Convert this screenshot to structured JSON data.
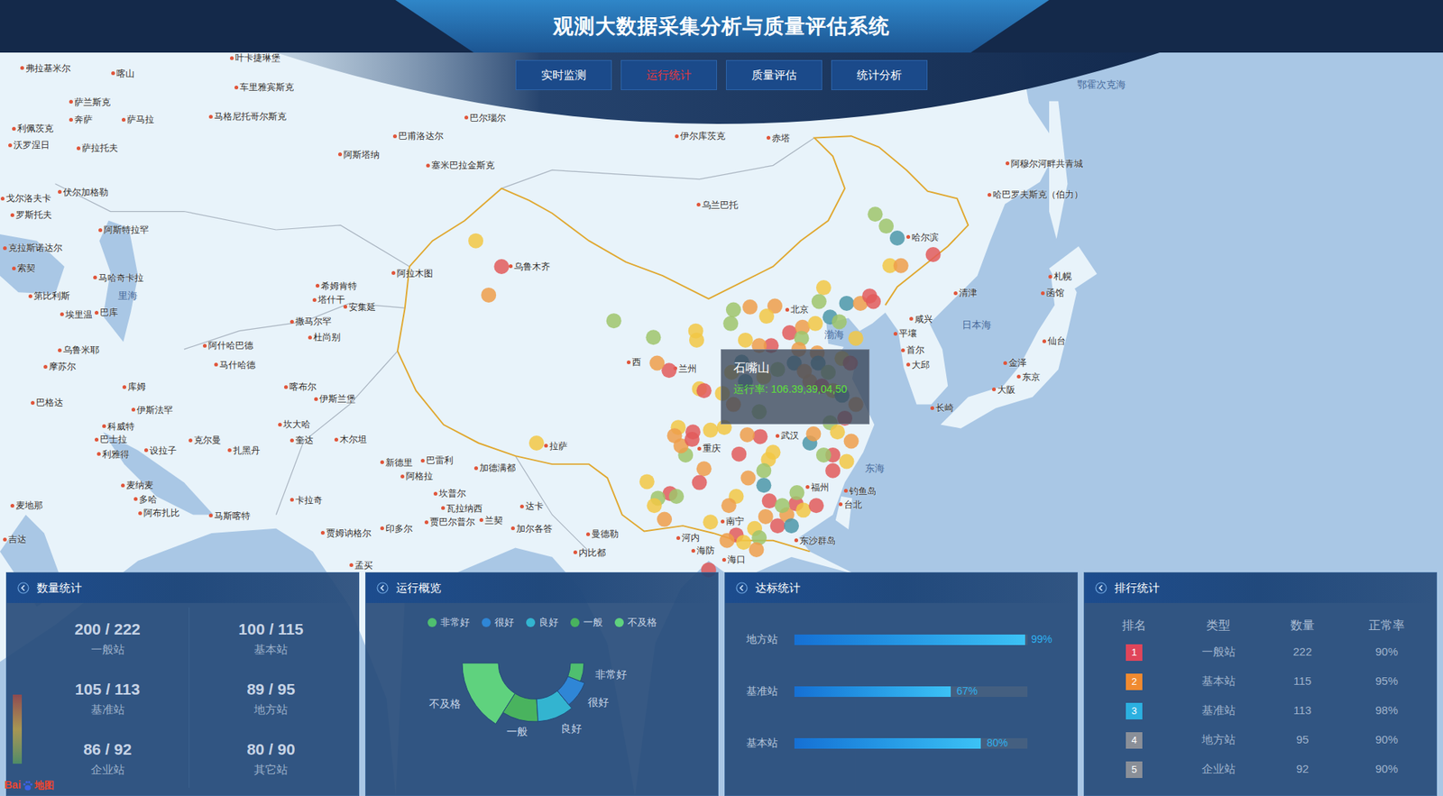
{
  "header": {
    "title": "观测大数据采集分析与质量评估系统"
  },
  "tabs": [
    {
      "label": "实时监测",
      "selected": false
    },
    {
      "label": "运行统计",
      "selected": true
    },
    {
      "label": "质量评估",
      "selected": false
    },
    {
      "label": "统计分析",
      "selected": false
    }
  ],
  "map": {
    "labels": [
      {
        "text": "弗拉基米尔",
        "kind": "city"
      },
      {
        "text": "喀山",
        "kind": "city"
      },
      {
        "text": "叶卡捷琳堡",
        "kind": "city"
      },
      {
        "text": "车里雅宾斯克",
        "kind": "city"
      },
      {
        "text": "萨兰斯克",
        "kind": "city"
      },
      {
        "text": "奔萨",
        "kind": "city"
      },
      {
        "text": "萨马拉",
        "kind": "city"
      },
      {
        "text": "马格尼托哥尔斯克",
        "kind": "city"
      },
      {
        "text": "巴尔瑙尔",
        "kind": "city"
      },
      {
        "text": "利佩茨克",
        "kind": "city"
      },
      {
        "text": "巴甫洛达尔",
        "kind": "city"
      },
      {
        "text": "伊尔库茨克",
        "kind": "city"
      },
      {
        "text": "赤塔",
        "kind": "city"
      },
      {
        "text": "沃罗涅日",
        "kind": "city"
      },
      {
        "text": "萨拉托夫",
        "kind": "city"
      },
      {
        "text": "阿斯塔纳",
        "kind": "city"
      },
      {
        "text": "塞米巴拉金斯克",
        "kind": "city"
      },
      {
        "text": "阿穆尔河畔共青城",
        "kind": "city"
      },
      {
        "text": "哈巴罗夫斯克（伯力）",
        "kind": "city"
      },
      {
        "text": "伏尔加格勒",
        "kind": "city"
      },
      {
        "text": "戈尔洛夫卡",
        "kind": "city"
      },
      {
        "text": "罗斯托夫",
        "kind": "city"
      },
      {
        "text": "乌兰巴托",
        "kind": "city"
      },
      {
        "text": "阿斯特拉罕",
        "kind": "city"
      },
      {
        "text": "哈尔滨",
        "kind": "city"
      },
      {
        "text": "克拉斯诺达尔",
        "kind": "city"
      },
      {
        "text": "乌鲁木齐",
        "kind": "city"
      },
      {
        "text": "索契",
        "kind": "city"
      },
      {
        "text": "阿拉木图",
        "kind": "city"
      },
      {
        "text": "马哈奇卡拉",
        "kind": "city"
      },
      {
        "text": "札幌",
        "kind": "city"
      },
      {
        "text": "希姆肯特",
        "kind": "city"
      },
      {
        "text": "第比利斯",
        "kind": "city"
      },
      {
        "text": "里海",
        "kind": "sea"
      },
      {
        "text": "塔什干",
        "kind": "city"
      },
      {
        "text": "函馆",
        "kind": "city"
      },
      {
        "text": "清津",
        "kind": "city"
      },
      {
        "text": "安集延",
        "kind": "city"
      },
      {
        "text": "北京",
        "kind": "city"
      },
      {
        "text": "巴库",
        "kind": "city"
      },
      {
        "text": "埃里温",
        "kind": "city"
      },
      {
        "text": "撒马尔罕",
        "kind": "city"
      },
      {
        "text": "咸兴",
        "kind": "city"
      },
      {
        "text": "日本海",
        "kind": "sea"
      },
      {
        "text": "杜尚别",
        "kind": "city"
      },
      {
        "text": "平壤",
        "kind": "city"
      },
      {
        "text": "渤海",
        "kind": "sea"
      },
      {
        "text": "阿什哈巴德",
        "kind": "city"
      },
      {
        "text": "仙台",
        "kind": "city"
      },
      {
        "text": "首尔",
        "kind": "city"
      },
      {
        "text": "乌鲁米耶",
        "kind": "city"
      },
      {
        "text": "马什哈德",
        "kind": "city"
      },
      {
        "text": "西",
        "kind": "city"
      },
      {
        "text": "兰州",
        "kind": "city"
      },
      {
        "text": "大邱",
        "kind": "city"
      },
      {
        "text": "金泽",
        "kind": "city"
      },
      {
        "text": "东京",
        "kind": "city"
      },
      {
        "text": "摩苏尔",
        "kind": "city"
      },
      {
        "text": "喀布尔",
        "kind": "city"
      },
      {
        "text": "大阪",
        "kind": "city"
      },
      {
        "text": "库姆",
        "kind": "city"
      },
      {
        "text": "伊斯兰堡",
        "kind": "city"
      },
      {
        "text": "巴格达",
        "kind": "city"
      },
      {
        "text": "伊斯法罕",
        "kind": "city"
      },
      {
        "text": "长崎",
        "kind": "city"
      },
      {
        "text": "坎大哈",
        "kind": "city"
      },
      {
        "text": "科威特",
        "kind": "city"
      },
      {
        "text": "武汉",
        "kind": "city"
      },
      {
        "text": "巴士拉",
        "kind": "city"
      },
      {
        "text": "木尔坦",
        "kind": "city"
      },
      {
        "text": "奎达",
        "kind": "city"
      },
      {
        "text": "克尔曼",
        "kind": "city"
      },
      {
        "text": "设拉子",
        "kind": "city"
      },
      {
        "text": "拉萨",
        "kind": "city"
      },
      {
        "text": "扎黑丹",
        "kind": "city"
      },
      {
        "text": "重庆",
        "kind": "city"
      },
      {
        "text": "利雅得",
        "kind": "city"
      },
      {
        "text": "新德里",
        "kind": "city"
      },
      {
        "text": "巴雷利",
        "kind": "city"
      },
      {
        "text": "加德满都",
        "kind": "city"
      },
      {
        "text": "东海",
        "kind": "sea"
      },
      {
        "text": "阿格拉",
        "kind": "city"
      },
      {
        "text": "麦纳麦",
        "kind": "city"
      },
      {
        "text": "福州",
        "kind": "city"
      },
      {
        "text": "钓鱼岛",
        "kind": "city"
      },
      {
        "text": "坎普尔",
        "kind": "city"
      },
      {
        "text": "多哈",
        "kind": "city"
      },
      {
        "text": "卡拉奇",
        "kind": "city"
      },
      {
        "text": "台北",
        "kind": "city"
      },
      {
        "text": "瓦拉纳西",
        "kind": "city"
      },
      {
        "text": "达卡",
        "kind": "city"
      },
      {
        "text": "阿布扎比",
        "kind": "city"
      },
      {
        "text": "麦地那",
        "kind": "city"
      },
      {
        "text": "马斯喀特",
        "kind": "city"
      },
      {
        "text": "兰契",
        "kind": "city"
      },
      {
        "text": "贾巴尔普尔",
        "kind": "city"
      },
      {
        "text": "南宁",
        "kind": "city"
      },
      {
        "text": "印多尔",
        "kind": "city"
      },
      {
        "text": "加尔各答",
        "kind": "city"
      },
      {
        "text": "贾姆讷格尔",
        "kind": "city"
      },
      {
        "text": "曼德勒",
        "kind": "city"
      },
      {
        "text": "河内",
        "kind": "city"
      },
      {
        "text": "吉达",
        "kind": "city"
      },
      {
        "text": "东沙群岛",
        "kind": "city"
      },
      {
        "text": "海防",
        "kind": "city"
      },
      {
        "text": "内比都",
        "kind": "city"
      },
      {
        "text": "海口",
        "kind": "city"
      },
      {
        "text": "孟买",
        "kind": "city"
      },
      {
        "text": "鄂霍次克海",
        "kind": "sea"
      }
    ],
    "stations": [
      {
        "color": "#f2c744"
      },
      {
        "color": "#e25b5b"
      },
      {
        "color": "#ef9d4a"
      },
      {
        "color": "#9fc46b"
      },
      {
        "color": "#9fc46b"
      },
      {
        "color": "#f2c744"
      },
      {
        "color": "#f2c744"
      },
      {
        "color": "#e25b5b"
      },
      {
        "color": "#ef9d4a"
      },
      {
        "color": "#9fc46b"
      },
      {
        "color": "#9fc46b"
      },
      {
        "color": "#4c97a8"
      },
      {
        "color": "#e25b5b"
      },
      {
        "color": "#f2c744"
      },
      {
        "color": "#ef9d4a"
      },
      {
        "color": "#f2c744"
      },
      {
        "color": "#ef9d4a"
      },
      {
        "color": "#9fc46b"
      },
      {
        "color": "#9fc46b"
      },
      {
        "color": "#ef9d4a"
      },
      {
        "color": "#f2c744"
      },
      {
        "color": "#9fc46b"
      },
      {
        "color": "#e25b5b"
      },
      {
        "color": "#ef9d4a"
      },
      {
        "color": "#9fc46b"
      },
      {
        "color": "#f2c744"
      },
      {
        "color": "#4c97a8"
      },
      {
        "color": "#ef9d4a"
      },
      {
        "color": "#e25b5b"
      },
      {
        "color": "#e25b5b"
      },
      {
        "color": "#4c97a8"
      },
      {
        "color": "#9fc46b"
      },
      {
        "color": "#f2c744"
      },
      {
        "color": "#ef9d4a"
      },
      {
        "color": "#4c97a8"
      },
      {
        "color": "#ef9d4a"
      },
      {
        "color": "#e25b5b"
      },
      {
        "color": "#ef9d4a"
      },
      {
        "color": "#f2c744"
      },
      {
        "color": "#9fc46b"
      },
      {
        "color": "#f2c744"
      },
      {
        "color": "#e25b5b"
      },
      {
        "color": "#4c97a8"
      },
      {
        "color": "#ef9d4a"
      },
      {
        "color": "#9fc46b"
      },
      {
        "color": "#f2c744"
      },
      {
        "color": "#4c97a8"
      },
      {
        "color": "#f2c744"
      },
      {
        "color": "#4c97a8"
      },
      {
        "color": "#ef9d4a"
      },
      {
        "color": "#e25b5b"
      },
      {
        "color": "#f2c744"
      },
      {
        "color": "#4c97a8"
      },
      {
        "color": "#ef9d4a"
      },
      {
        "color": "#e25b5b"
      },
      {
        "color": "#9fc46b"
      },
      {
        "color": "#f2c744"
      },
      {
        "color": "#ef9d4a"
      },
      {
        "color": "#e25b5b"
      },
      {
        "color": "#f2c744"
      },
      {
        "color": "#9fc46b"
      },
      {
        "color": "#4c97a8"
      },
      {
        "color": "#ef9d4a"
      },
      {
        "color": "#f2c744"
      },
      {
        "color": "#e25b5b"
      },
      {
        "color": "#ef9d4a"
      },
      {
        "color": "#f2c744"
      },
      {
        "color": "#e25b5b"
      },
      {
        "color": "#9fc46b"
      },
      {
        "color": "#ef9d4a"
      },
      {
        "color": "#4c97a8"
      },
      {
        "color": "#f2c744"
      },
      {
        "color": "#e25b5b"
      },
      {
        "color": "#f2c744"
      },
      {
        "color": "#ef9d4a"
      },
      {
        "color": "#9fc46b"
      },
      {
        "color": "#f2c744"
      },
      {
        "color": "#f2c744"
      },
      {
        "color": "#ef9d4a"
      },
      {
        "color": "#e25b5b"
      },
      {
        "color": "#9fc46b"
      },
      {
        "color": "#ef9d4a"
      },
      {
        "color": "#e25b5b"
      },
      {
        "color": "#f2c744"
      },
      {
        "color": "#ef9d4a"
      },
      {
        "color": "#e25b5b"
      },
      {
        "color": "#f2c744"
      },
      {
        "color": "#e25b5b"
      },
      {
        "color": "#9fc46b"
      },
      {
        "color": "#f2c744"
      },
      {
        "color": "#9fc46b"
      },
      {
        "color": "#ef9d4a"
      },
      {
        "color": "#f2c744"
      },
      {
        "color": "#ef9d4a"
      },
      {
        "color": "#e25b5b"
      },
      {
        "color": "#ef9d4a"
      },
      {
        "color": "#f2c744"
      },
      {
        "color": "#e25b5b"
      },
      {
        "color": "#ef9d4a"
      },
      {
        "color": "#f2c744"
      },
      {
        "color": "#9fc46b"
      },
      {
        "color": "#e25b5b"
      },
      {
        "color": "#ef9d4a"
      },
      {
        "color": "#e25b5b"
      },
      {
        "color": "#f2c744"
      },
      {
        "color": "#9fc46b"
      },
      {
        "color": "#4c97a8"
      },
      {
        "color": "#e25b5b"
      },
      {
        "color": "#9fc46b"
      },
      {
        "color": "#e25b5b"
      },
      {
        "color": "#f2c744"
      },
      {
        "color": "#ef9d4a"
      },
      {
        "color": "#e25b5b"
      },
      {
        "color": "#f2c744"
      }
    ],
    "tooltip": {
      "title": "石嘴山",
      "value": "运行率: 106.39,39,04,50"
    },
    "logo": {
      "text": "Bai",
      "suffix": "地图"
    }
  },
  "count_panel": {
    "title": "数量统计",
    "items": [
      {
        "value": "200 / 222",
        "label": "一般站"
      },
      {
        "value": "100 / 115",
        "label": "基本站"
      },
      {
        "value": "105 / 113",
        "label": "基准站"
      },
      {
        "value": "89 / 95",
        "label": "地方站"
      },
      {
        "value": "86 / 92",
        "label": "企业站"
      },
      {
        "value": "80 / 90",
        "label": "其它站"
      }
    ]
  },
  "overview_panel": {
    "title": "运行概览",
    "legend": [
      {
        "label": "非常好",
        "color": "#4fbf6f"
      },
      {
        "label": "很好",
        "color": "#2f86d6"
      },
      {
        "label": "良好",
        "color": "#33b4d0"
      },
      {
        "label": "一般",
        "color": "#49b35e"
      },
      {
        "label": "不及格",
        "color": "#5fd27e"
      }
    ],
    "segments": [
      {
        "label": "不及格",
        "value": 32,
        "color": "#5fd27e"
      },
      {
        "label": "一般",
        "value": 20,
        "color": "#49b35e"
      },
      {
        "label": "良好",
        "value": 20,
        "color": "#33b4d0"
      },
      {
        "label": "很好",
        "value": 16,
        "color": "#2f86d6"
      },
      {
        "label": "非常好",
        "value": 12,
        "color": "#4fbf6f"
      }
    ]
  },
  "standard_panel": {
    "title": "达标统计",
    "bars": [
      {
        "label": "地方站",
        "level": 0.99,
        "reading": "99%"
      },
      {
        "label": "基准站",
        "level": 0.67,
        "reading": "67%"
      },
      {
        "label": "基本站",
        "level": 0.8,
        "reading": "80%"
      }
    ]
  },
  "ranking_panel": {
    "title": "排行统计",
    "columns": [
      "排名",
      "类型",
      "数量",
      "正常率"
    ],
    "rows": [
      {
        "rank": "1",
        "type": "一般站",
        "count": "222",
        "rate": "90%",
        "color": "#e0455a"
      },
      {
        "rank": "2",
        "type": "基本站",
        "count": "115",
        "rate": "95%",
        "color": "#f08a30"
      },
      {
        "rank": "3",
        "type": "基准站",
        "count": "113",
        "rate": "98%",
        "color": "#2bb0e0"
      },
      {
        "rank": "4",
        "type": "地方站",
        "count": "95",
        "rate": "90%",
        "color": "#8a8f98"
      },
      {
        "rank": "5",
        "type": "企业站",
        "count": "92",
        "rate": "90%",
        "color": "#8a8f98"
      }
    ]
  }
}
